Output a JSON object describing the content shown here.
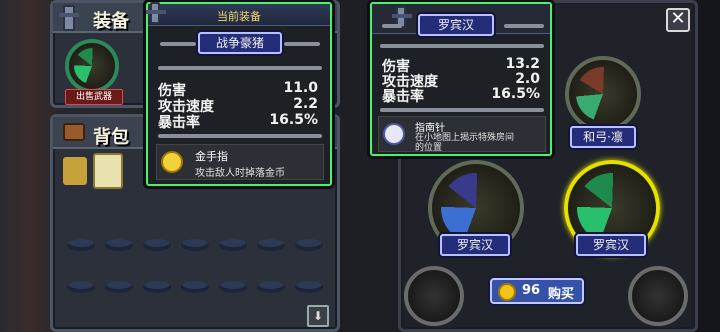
{
  "equipment_panel": {
    "title": "装备",
    "sell_button": "出售武器"
  },
  "current_equip_label": "当前装备",
  "backpack_panel": {
    "title": "背包"
  },
  "current_tooltip": {
    "name": "战争豪猪",
    "stats": [
      {
        "label": "伤害",
        "value": "11.0"
      },
      {
        "label": "攻击速度",
        "value": "2.2"
      },
      {
        "label": "暴击率",
        "value": "16.5%"
      }
    ],
    "perk": {
      "name": "金手指",
      "desc": "攻击敌人时掉落金币"
    }
  },
  "compare_tooltip": {
    "name": "罗宾汉",
    "stats": [
      {
        "label": "伤害",
        "value": "13.2"
      },
      {
        "label": "攻击速度",
        "value": "2.0"
      },
      {
        "label": "暴击率",
        "value": "16.5%"
      }
    ],
    "perk": {
      "name": "指南针",
      "desc_line1": "在小地图上揭示特殊房间",
      "desc_line2": "的位置"
    }
  },
  "weapons": [
    {
      "name": "和弓·凛"
    },
    {
      "name": "罗宾汉"
    },
    {
      "name": "罗宾汉"
    }
  ],
  "buy_button": {
    "price": "96",
    "label": "购买"
  },
  "icons": [
    "sword-icon",
    "bow-icon",
    "gold-fingers-icon",
    "compass-icon",
    "coin-icon",
    "close-icon"
  ],
  "colors": {
    "tooltip_border": "#4cf06a",
    "selected_ring": "#e6e000",
    "nameplate": "#242d7a"
  }
}
